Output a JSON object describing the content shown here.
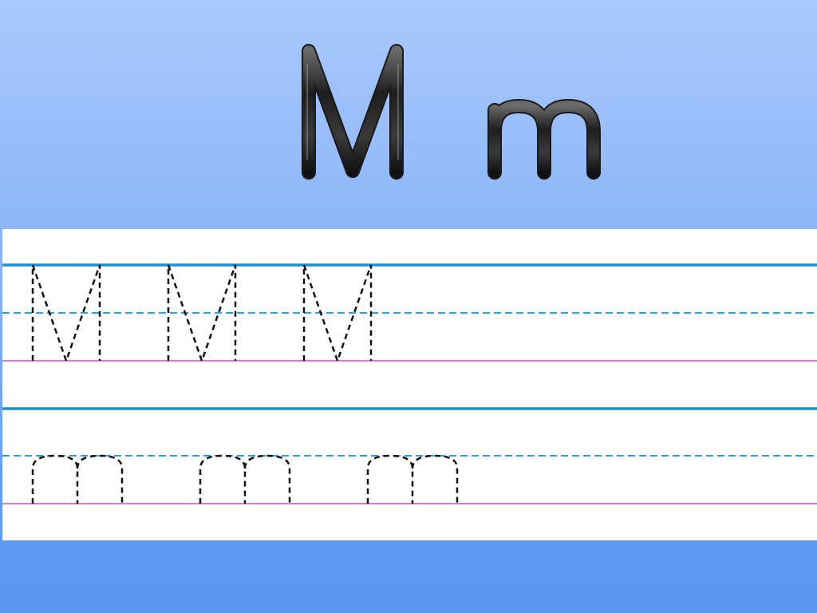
{
  "title": {
    "uppercase": "M",
    "lowercase": "m"
  },
  "practice": {
    "rows": [
      {
        "name": "uppercase-row",
        "glyph": "M",
        "count": 3
      },
      {
        "name": "lowercase-row",
        "glyph": "m",
        "count": 3
      }
    ],
    "colors": {
      "top_line": "#1a8fd6",
      "mid_line": "#29a3e0",
      "base_line": "#e07ad0",
      "trace_stroke": "#111111"
    }
  }
}
